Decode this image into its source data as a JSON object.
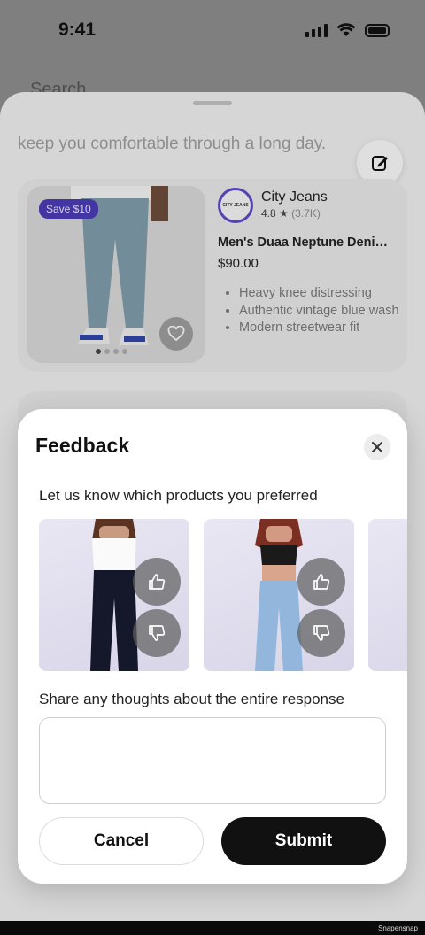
{
  "status_bar": {
    "time": "9:41"
  },
  "background": {
    "search_placeholder": "Search",
    "response_text": "keep you comfortable through a long day.",
    "product": {
      "badge": "Save $10",
      "brand_logo_text": "CITY JEANS",
      "brand_name": "City Jeans",
      "rating": "4.8",
      "rating_count": "(3.7K)",
      "title": "Men's Duaa Neptune Denim Jeans",
      "price": "$90.00",
      "bullets": [
        "Heavy knee distressing",
        "Authentic vintage blue wash",
        "Modern streetwear fit"
      ]
    }
  },
  "feedback": {
    "title": "Feedback",
    "prompt_products": "Let us know which products you preferred",
    "prompt_thoughts": "Share any thoughts about the entire response",
    "thoughts_value": "",
    "cancel_label": "Cancel",
    "submit_label": "Submit"
  },
  "footer": {
    "watermark": "Snapensnap"
  },
  "colors": {
    "accent": "#4a3bb0",
    "primary_button": "#111111",
    "modal_bg": "#ffffff"
  }
}
